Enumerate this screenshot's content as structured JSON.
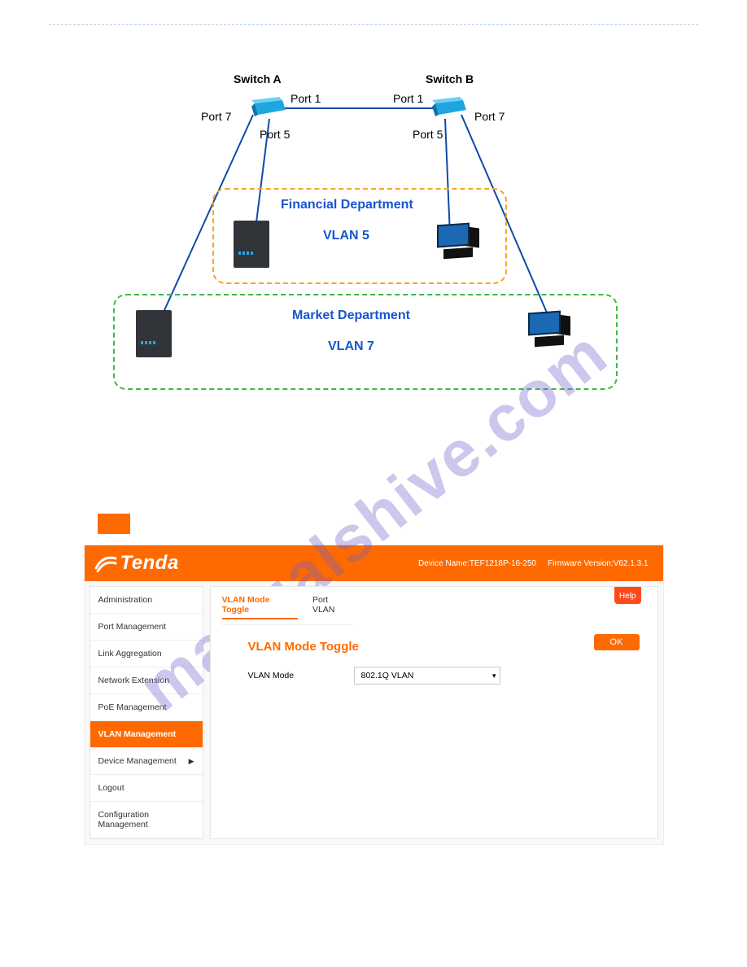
{
  "watermark": "manualshive.com",
  "diagram": {
    "switch_a_label": "Switch A",
    "switch_b_label": "Switch B",
    "port1_a": "Port 1",
    "port1_b": "Port 1",
    "port5_a": "Port 5",
    "port5_b": "Port 5",
    "port7_a": "Port 7",
    "port7_b": "Port 7",
    "vlan5_title": "Financial Department",
    "vlan5_name": "VLAN 5",
    "vlan7_title": "Market Department",
    "vlan7_name": "VLAN 7"
  },
  "header": {
    "brand": "Tenda",
    "device_name_label": "Device Name:",
    "device_name": "TEF1218P-16-250",
    "firmware_label": "Firmware Version:",
    "firmware": "V62.1.3.1"
  },
  "sidebar": {
    "items": [
      {
        "label": "Administration",
        "active": false
      },
      {
        "label": "Port Management",
        "active": false
      },
      {
        "label": "Link Aggregation",
        "active": false
      },
      {
        "label": "Network Extension",
        "active": false
      },
      {
        "label": "PoE Management",
        "active": false
      },
      {
        "label": "VLAN Management",
        "active": true
      },
      {
        "label": "Device Management",
        "active": false,
        "arrow": true
      },
      {
        "label": "Logout",
        "active": false
      },
      {
        "label": "Configuration Management",
        "active": false
      }
    ]
  },
  "content": {
    "help_label": "Help",
    "tabs": {
      "t1": "VLAN Mode Toggle",
      "t2": "Port VLAN"
    },
    "section_title": "VLAN Mode Toggle",
    "vlan_mode_label": "VLAN Mode",
    "vlan_mode_value": "802.1Q VLAN",
    "ok_label": "OK"
  }
}
